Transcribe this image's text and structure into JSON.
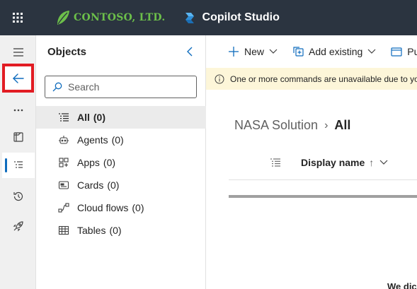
{
  "topbar": {
    "brand_name": "CONTOSO, LTD.",
    "product_name": "Copilot Studio",
    "background": "#2b3440",
    "brand_color": "#6cbf4a"
  },
  "rail": {
    "items": [
      {
        "name": "menu",
        "icon": "hamburger-icon"
      },
      {
        "name": "back",
        "icon": "arrow-left-icon",
        "highlighted": true
      },
      {
        "name": "more",
        "icon": "more-icon"
      },
      {
        "name": "view",
        "icon": "panel-icon"
      },
      {
        "name": "objects",
        "icon": "list-icon",
        "active": true
      },
      {
        "name": "history",
        "icon": "history-icon"
      },
      {
        "name": "deploy",
        "icon": "rocket-icon"
      }
    ]
  },
  "panel": {
    "title": "Objects",
    "search_placeholder": "Search",
    "items": [
      {
        "label": "All",
        "count": "(0)",
        "icon": "list-icon",
        "selected": true
      },
      {
        "label": "Agents",
        "count": "(0)",
        "icon": "bot-icon"
      },
      {
        "label": "Apps",
        "count": "(0)",
        "icon": "apps-icon"
      },
      {
        "label": "Cards",
        "count": "(0)",
        "icon": "card-icon"
      },
      {
        "label": "Cloud flows",
        "count": "(0)",
        "icon": "flow-icon"
      },
      {
        "label": "Tables",
        "count": "(0)",
        "icon": "table-icon"
      }
    ]
  },
  "commandbar": {
    "new_label": "New",
    "add_existing_label": "Add existing",
    "publish_label": "Pul"
  },
  "notice": {
    "text": "One or more commands are unavailable due to yo"
  },
  "breadcrumb": {
    "parent": "NASA Solution",
    "current": "All"
  },
  "table": {
    "column_label": "Display name",
    "sort_arrow": "↑"
  },
  "footer": {
    "partial_text": "We dic"
  },
  "colors": {
    "accent": "#0f6cbd",
    "highlight": "#e21c23",
    "notice_bg": "#fdf6d9"
  }
}
